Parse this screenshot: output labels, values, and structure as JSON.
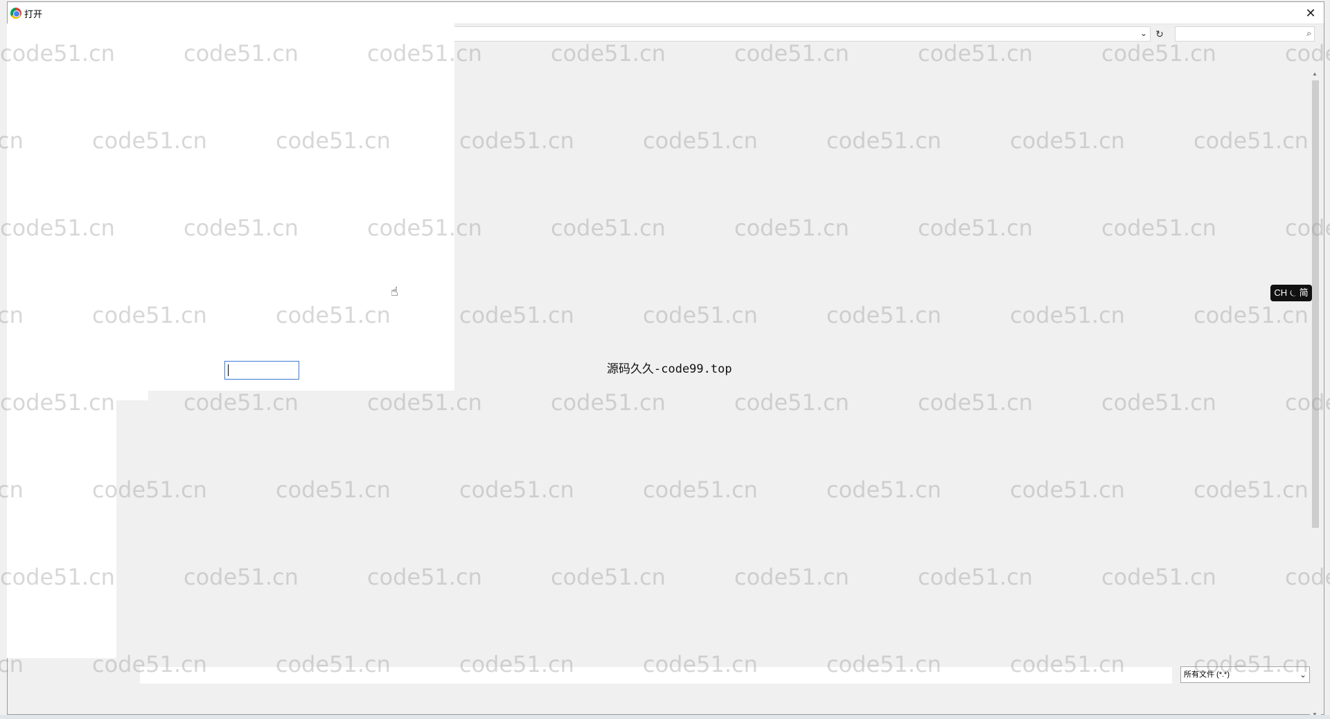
{
  "titlebar": {
    "title": "打开",
    "close_glyph": "✕"
  },
  "toolbar": {
    "refresh_glyph": "↻",
    "dropdown_glyph": "⌄",
    "search_glyph": "⌕"
  },
  "file_type": {
    "selected": "所有文件 (*.*)"
  },
  "ime": {
    "label": "CH ⏾ 简"
  },
  "overlay_text": "源码久久-code99.top",
  "watermark": {
    "text": "code51.cn"
  },
  "colors": {
    "dialog_bg": "#f0f0f0",
    "focus_border": "#3a7bd5",
    "ime_bg": "#111111"
  }
}
